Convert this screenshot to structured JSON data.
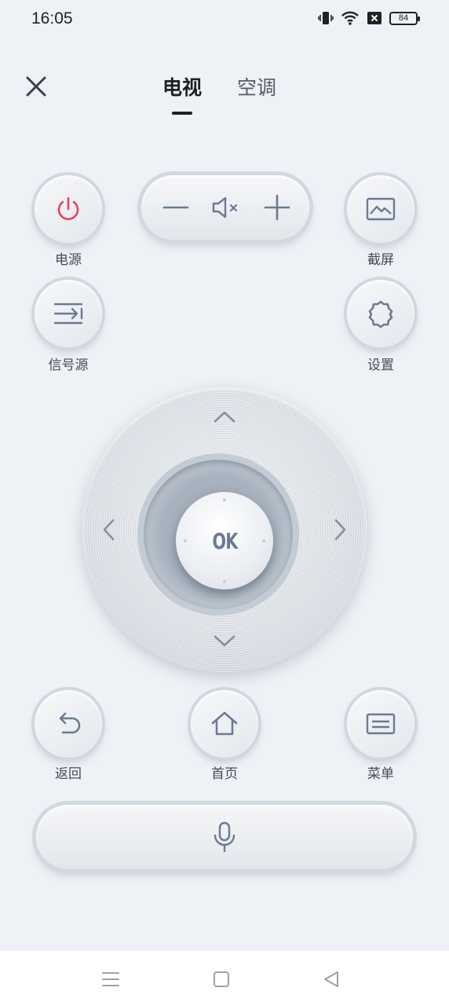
{
  "status_bar": {
    "time": "16:05",
    "battery": "84",
    "icons": [
      "vibrate-icon",
      "wifi-icon",
      "no-sim-icon",
      "battery-icon"
    ]
  },
  "tabs": [
    {
      "label": "电视",
      "active": true
    },
    {
      "label": "空调",
      "active": false
    }
  ],
  "buttons": {
    "power": "电源",
    "screenshot": "截屏",
    "source": "信号源",
    "settings": "设置",
    "ok": "OK",
    "back": "返回",
    "home": "首页",
    "menu": "菜单"
  },
  "volume": {
    "icons": [
      "minus-icon",
      "mute-icon",
      "plus-icon"
    ]
  },
  "colors": {
    "background": "#eef1f5",
    "power_accent": "#e8425c",
    "icon": "#6b7a93"
  }
}
